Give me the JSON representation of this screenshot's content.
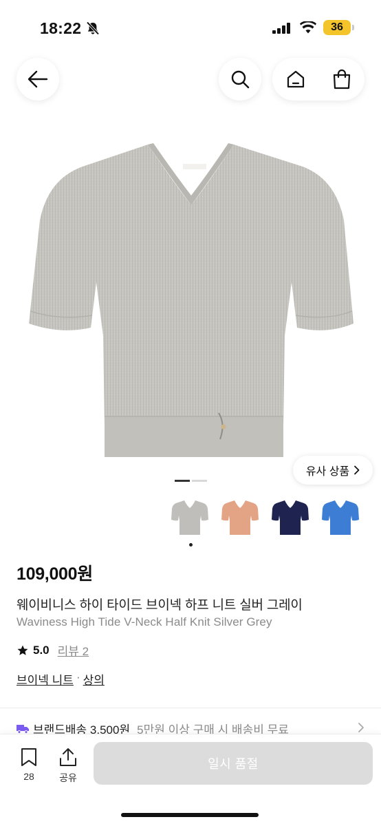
{
  "status_bar": {
    "time": "18:22",
    "battery_level": "36",
    "battery_color": "#F3C52B"
  },
  "top_nav": {
    "back_icon": "arrow-left-icon",
    "search_icon": "search-icon",
    "home_icon": "home-icon",
    "bag_icon": "shopping-bag-icon"
  },
  "gallery": {
    "similar_label": "유사 상품",
    "page_count": 2,
    "current_page": 1
  },
  "swatches": [
    {
      "color": "#BFBEBA",
      "name": "grey"
    },
    {
      "color": "#E3A486",
      "name": "coral"
    },
    {
      "color": "#1E2350",
      "name": "navy"
    },
    {
      "color": "#3D7DD3",
      "name": "blue"
    }
  ],
  "product": {
    "price": "109,000원",
    "name_ko": "웨이비니스 하이 타이드 브이넥 하프 니트 실버 그레이",
    "name_en": "Waviness High Tide V-Neck Half Knit Silver Grey",
    "rating": "5.0",
    "review_label": "리뷰 2",
    "category_main": "브이넥 니트",
    "category_sep": "·",
    "category_sub": "상의"
  },
  "shipping": {
    "label": "브랜드배송 3,500원",
    "note": "5만원 이상 구매 시 배송비 무료",
    "truck_color": "#7B5CF0"
  },
  "bottom_bar": {
    "like_count": "28",
    "share_label": "공유",
    "button_label": "일시 품절"
  }
}
